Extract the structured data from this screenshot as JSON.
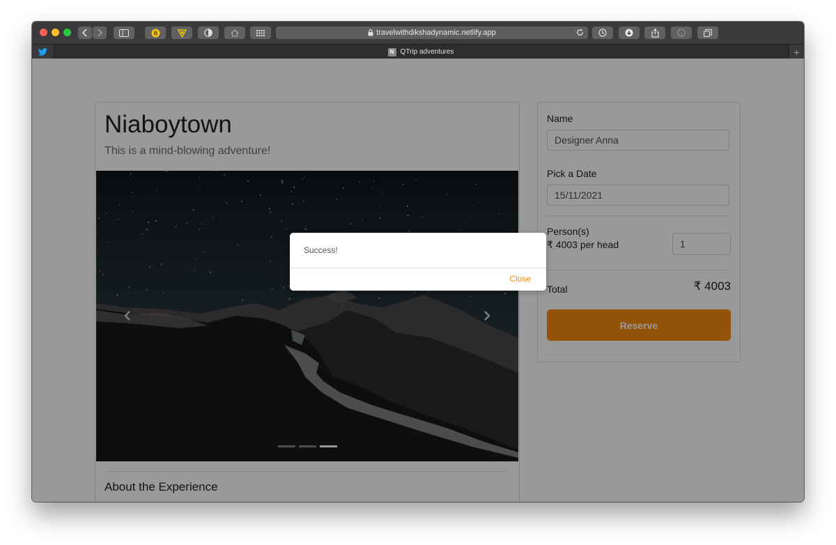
{
  "browser": {
    "url": "travelwithdikshadynamic.netlify.app",
    "tab_title": "QTrip adventures",
    "tab_favicon_letter": "N",
    "pinned_tab_icon": "twitter-icon",
    "toolbar_icons": [
      "back-icon",
      "forward-icon",
      "sidebar-icon",
      "bitcoin-extension-icon",
      "shield-extension-icon",
      "privacy-extension-icon",
      "home-icon",
      "grid-icon",
      "reload-icon",
      "history-icon",
      "download-icon",
      "share-icon",
      "info-icon",
      "tabs-overview-icon"
    ]
  },
  "adventure": {
    "title": "Niaboytown",
    "subtitle": "This is a mind-blowing adventure!",
    "about_heading": "About the Experience"
  },
  "carousel": {
    "slide_count": 3,
    "active_index": 2
  },
  "reservation": {
    "name_label": "Name",
    "name_value": "Designer Anna",
    "date_label": "Pick a Date",
    "date_value": "15/11/2021",
    "persons_label": "Person(s)",
    "per_head": "₹ 4003 per head",
    "persons_value": "1",
    "total_label": "Total",
    "total_value": "₹ 4003",
    "reserve_label": "Reserve"
  },
  "modal": {
    "message": "Success!",
    "close_label": "Close"
  },
  "colors": {
    "accent": "#f58a0e",
    "overlay": "rgba(0,0,0,0.40)"
  }
}
